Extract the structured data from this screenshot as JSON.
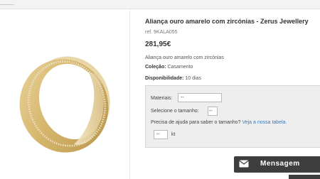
{
  "product": {
    "title": "Aliança ouro amarelo com zircónias - Zerus Jewellery",
    "ref": "ref. 9KALA055",
    "price": "281,95€",
    "description": "Aliança ouro amarelo com zircónias",
    "collection_label": "Coleção:",
    "collection_value": "Casamento",
    "availability_label": "Disponibilidade:",
    "availability_value": "10 dias"
  },
  "options": {
    "materials_label": "Materiais:",
    "materials_value": "--",
    "size_label": "Selecione o tamanho:",
    "size_value": "--",
    "help_text": "Precisa de ajuda para saber o tamanho?",
    "help_link": "Veja a nossa tabela.",
    "kt_value": "--",
    "kt_unit": "kt"
  },
  "message_button": {
    "label": "Mensagem",
    "icon": "envelope-icon"
  },
  "colors": {
    "ring_gold": "#d9bf7a",
    "button_bg": "#3e3e3e",
    "link": "#3a7bbf"
  }
}
